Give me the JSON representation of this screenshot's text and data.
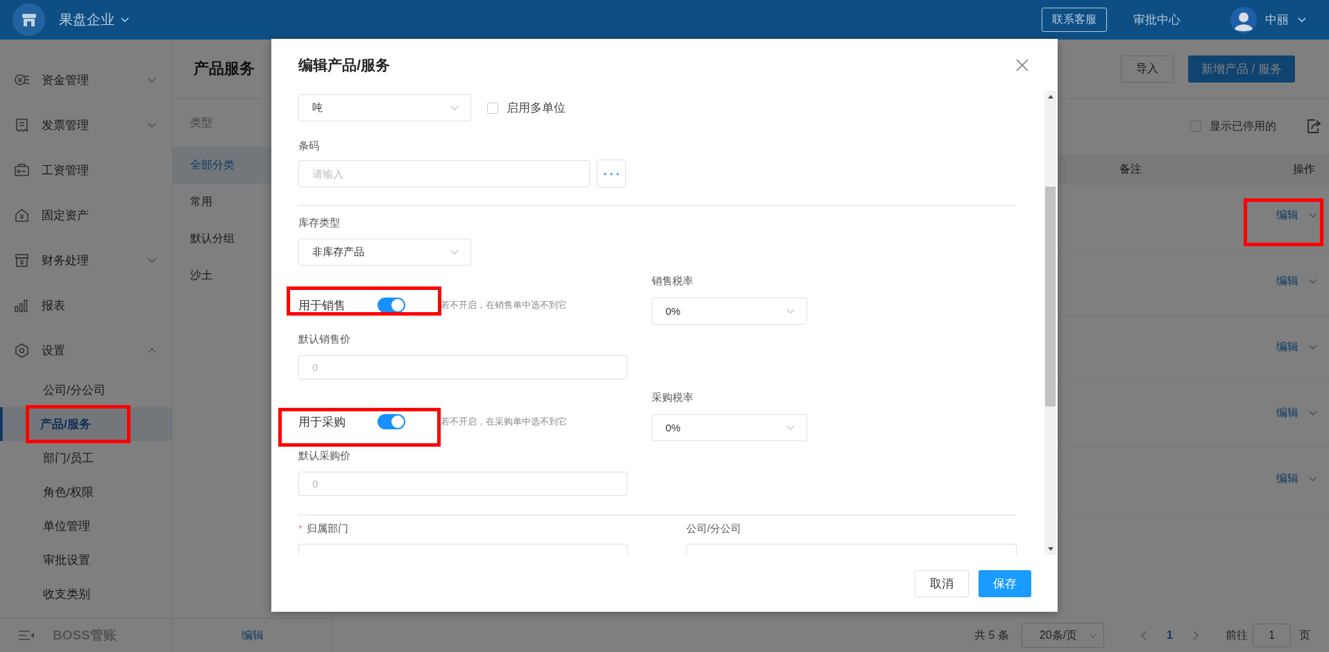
{
  "top_bar": {
    "company": "果盘企业",
    "contact_button": "联系客服",
    "approval_center": "审批中心",
    "user": "中丽"
  },
  "sidebar": {
    "items": [
      {
        "label": "资金管理",
        "expanded": false
      },
      {
        "label": "发票管理",
        "expanded": false
      },
      {
        "label": "工资管理"
      },
      {
        "label": "固定资产"
      },
      {
        "label": "财务处理",
        "expanded": false
      },
      {
        "label": "报表"
      },
      {
        "label": "设置",
        "expanded": true,
        "children": [
          {
            "label": "公司/分公司",
            "selected": false,
            "highlighted": false
          },
          {
            "label": "产品/服务",
            "selected": true,
            "highlighted": true
          },
          {
            "label": "部门/员工",
            "selected": false,
            "highlighted": false
          },
          {
            "label": "角色/权限",
            "selected": false,
            "highlighted": false
          },
          {
            "label": "单位管理",
            "selected": false,
            "highlighted": false
          },
          {
            "label": "审批设置",
            "selected": false,
            "highlighted": false
          },
          {
            "label": "收支类别",
            "selected": false,
            "highlighted": false
          }
        ]
      }
    ],
    "footer": "BOSS管账"
  },
  "category_panel": {
    "title": "产品服务",
    "heading": "类型",
    "items": [
      {
        "label": "全部分类",
        "selected": true
      },
      {
        "label": "常用",
        "selected": false
      },
      {
        "label": "默认分组",
        "selected": false
      },
      {
        "label": "沙土",
        "selected": false
      }
    ],
    "footer_link": "编辑"
  },
  "toolbar": {
    "import_button": "导入",
    "add_button": "新增产品 / 服务",
    "show_disabled": {
      "label": "显示已停用的",
      "checked": false
    }
  },
  "table": {
    "columns": [
      "备注",
      "操作"
    ],
    "rows": [
      {
        "action": "编辑",
        "highlighted": true
      },
      {
        "action": "编辑",
        "highlighted": false
      },
      {
        "action": "编辑",
        "highlighted": false
      },
      {
        "action": "编辑",
        "highlighted": false
      },
      {
        "action": "编辑",
        "highlighted": false
      }
    ]
  },
  "pagination": {
    "total": "共 5 条",
    "page_size": "20条/页",
    "pages": [
      {
        "label": "1",
        "selected": true
      }
    ],
    "goto_label": "前往",
    "goto_value": "1",
    "page_suffix": "页"
  },
  "dialog": {
    "title": "编辑产品/服务",
    "unit_select": "吨",
    "multi_unit": {
      "label": "启用多单位",
      "checked": false
    },
    "barcode": {
      "label": "条码",
      "placeholder": "请输入"
    },
    "stock_type": {
      "label": "库存类型",
      "value": "非库存产品"
    },
    "toggles": [
      {
        "label": "用于销售",
        "on": true,
        "highlighted": true,
        "hint": "若不开启，在销售单中选不到它",
        "tax_label": "销售税率",
        "tax_value": "0%",
        "price_label": "默认销售价",
        "price_placeholder": "0"
      },
      {
        "label": "用于采购",
        "on": true,
        "highlighted": true,
        "hint": "若不开启，在采购单中选不到它",
        "tax_label": "采购税率",
        "tax_value": "0%",
        "price_label": "默认采购价",
        "price_placeholder": "0"
      }
    ],
    "department": {
      "label": "归属部门",
      "required_mark": "*"
    },
    "company": {
      "label": "公司/分公司"
    },
    "buttons": [
      {
        "label": "取消",
        "kind": "secondary"
      },
      {
        "label": "保存",
        "kind": "primary"
      }
    ]
  }
}
